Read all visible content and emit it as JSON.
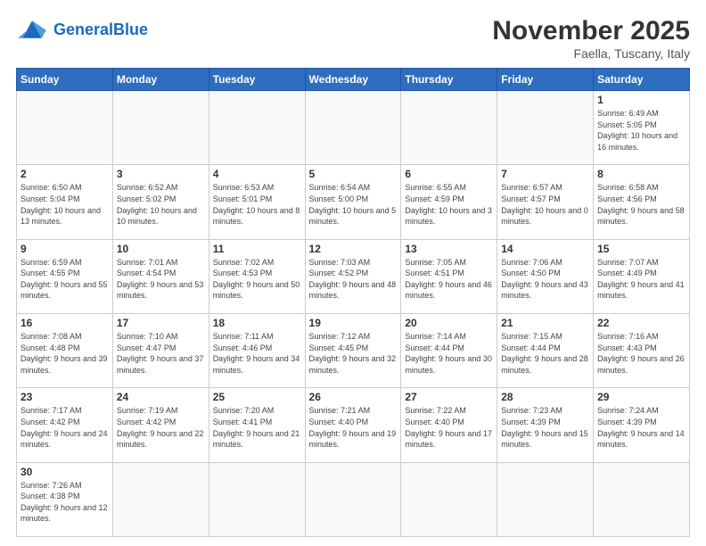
{
  "logo": {
    "text_general": "General",
    "text_blue": "Blue"
  },
  "header": {
    "month": "November 2025",
    "location": "Faella, Tuscany, Italy"
  },
  "days_of_week": [
    "Sunday",
    "Monday",
    "Tuesday",
    "Wednesday",
    "Thursday",
    "Friday",
    "Saturday"
  ],
  "weeks": [
    [
      {
        "day": "",
        "info": ""
      },
      {
        "day": "",
        "info": ""
      },
      {
        "day": "",
        "info": ""
      },
      {
        "day": "",
        "info": ""
      },
      {
        "day": "",
        "info": ""
      },
      {
        "day": "",
        "info": ""
      },
      {
        "day": "1",
        "info": "Sunrise: 6:49 AM\nSunset: 5:05 PM\nDaylight: 10 hours and 16 minutes."
      }
    ],
    [
      {
        "day": "2",
        "info": "Sunrise: 6:50 AM\nSunset: 5:04 PM\nDaylight: 10 hours and 13 minutes."
      },
      {
        "day": "3",
        "info": "Sunrise: 6:52 AM\nSunset: 5:02 PM\nDaylight: 10 hours and 10 minutes."
      },
      {
        "day": "4",
        "info": "Sunrise: 6:53 AM\nSunset: 5:01 PM\nDaylight: 10 hours and 8 minutes."
      },
      {
        "day": "5",
        "info": "Sunrise: 6:54 AM\nSunset: 5:00 PM\nDaylight: 10 hours and 5 minutes."
      },
      {
        "day": "6",
        "info": "Sunrise: 6:55 AM\nSunset: 4:59 PM\nDaylight: 10 hours and 3 minutes."
      },
      {
        "day": "7",
        "info": "Sunrise: 6:57 AM\nSunset: 4:57 PM\nDaylight: 10 hours and 0 minutes."
      },
      {
        "day": "8",
        "info": "Sunrise: 6:58 AM\nSunset: 4:56 PM\nDaylight: 9 hours and 58 minutes."
      }
    ],
    [
      {
        "day": "9",
        "info": "Sunrise: 6:59 AM\nSunset: 4:55 PM\nDaylight: 9 hours and 55 minutes."
      },
      {
        "day": "10",
        "info": "Sunrise: 7:01 AM\nSunset: 4:54 PM\nDaylight: 9 hours and 53 minutes."
      },
      {
        "day": "11",
        "info": "Sunrise: 7:02 AM\nSunset: 4:53 PM\nDaylight: 9 hours and 50 minutes."
      },
      {
        "day": "12",
        "info": "Sunrise: 7:03 AM\nSunset: 4:52 PM\nDaylight: 9 hours and 48 minutes."
      },
      {
        "day": "13",
        "info": "Sunrise: 7:05 AM\nSunset: 4:51 PM\nDaylight: 9 hours and 46 minutes."
      },
      {
        "day": "14",
        "info": "Sunrise: 7:06 AM\nSunset: 4:50 PM\nDaylight: 9 hours and 43 minutes."
      },
      {
        "day": "15",
        "info": "Sunrise: 7:07 AM\nSunset: 4:49 PM\nDaylight: 9 hours and 41 minutes."
      }
    ],
    [
      {
        "day": "16",
        "info": "Sunrise: 7:08 AM\nSunset: 4:48 PM\nDaylight: 9 hours and 39 minutes."
      },
      {
        "day": "17",
        "info": "Sunrise: 7:10 AM\nSunset: 4:47 PM\nDaylight: 9 hours and 37 minutes."
      },
      {
        "day": "18",
        "info": "Sunrise: 7:11 AM\nSunset: 4:46 PM\nDaylight: 9 hours and 34 minutes."
      },
      {
        "day": "19",
        "info": "Sunrise: 7:12 AM\nSunset: 4:45 PM\nDaylight: 9 hours and 32 minutes."
      },
      {
        "day": "20",
        "info": "Sunrise: 7:14 AM\nSunset: 4:44 PM\nDaylight: 9 hours and 30 minutes."
      },
      {
        "day": "21",
        "info": "Sunrise: 7:15 AM\nSunset: 4:44 PM\nDaylight: 9 hours and 28 minutes."
      },
      {
        "day": "22",
        "info": "Sunrise: 7:16 AM\nSunset: 4:43 PM\nDaylight: 9 hours and 26 minutes."
      }
    ],
    [
      {
        "day": "23",
        "info": "Sunrise: 7:17 AM\nSunset: 4:42 PM\nDaylight: 9 hours and 24 minutes."
      },
      {
        "day": "24",
        "info": "Sunrise: 7:19 AM\nSunset: 4:42 PM\nDaylight: 9 hours and 22 minutes."
      },
      {
        "day": "25",
        "info": "Sunrise: 7:20 AM\nSunset: 4:41 PM\nDaylight: 9 hours and 21 minutes."
      },
      {
        "day": "26",
        "info": "Sunrise: 7:21 AM\nSunset: 4:40 PM\nDaylight: 9 hours and 19 minutes."
      },
      {
        "day": "27",
        "info": "Sunrise: 7:22 AM\nSunset: 4:40 PM\nDaylight: 9 hours and 17 minutes."
      },
      {
        "day": "28",
        "info": "Sunrise: 7:23 AM\nSunset: 4:39 PM\nDaylight: 9 hours and 15 minutes."
      },
      {
        "day": "29",
        "info": "Sunrise: 7:24 AM\nSunset: 4:39 PM\nDaylight: 9 hours and 14 minutes."
      }
    ],
    [
      {
        "day": "30",
        "info": "Sunrise: 7:26 AM\nSunset: 4:38 PM\nDaylight: 9 hours and 12 minutes."
      },
      {
        "day": "",
        "info": ""
      },
      {
        "day": "",
        "info": ""
      },
      {
        "day": "",
        "info": ""
      },
      {
        "day": "",
        "info": ""
      },
      {
        "day": "",
        "info": ""
      },
      {
        "day": "",
        "info": ""
      }
    ]
  ]
}
